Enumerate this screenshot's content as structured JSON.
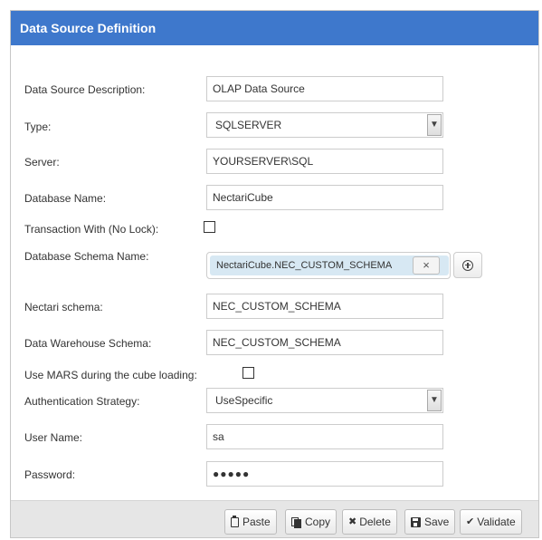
{
  "dialog": {
    "title": "Data Source Definition"
  },
  "form": {
    "description": {
      "label": "Data Source Description:",
      "value": "OLAP Data Source"
    },
    "type": {
      "label": "Type:",
      "value": "SQLSERVER"
    },
    "server": {
      "label": "Server:",
      "value": "YOURSERVER\\SQL"
    },
    "database_name": {
      "label": "Database Name:",
      "value": "NectariCube"
    },
    "transaction_nolock": {
      "label": "Transaction With (No Lock):",
      "checked": false
    },
    "schema_name": {
      "label": "Database Schema Name:",
      "tags": [
        "NectariCube.NEC_CUSTOM_SCHEMA"
      ],
      "remove_symbol": "×"
    },
    "nectari_schema": {
      "label": "Nectari schema:",
      "value": "NEC_CUSTOM_SCHEMA"
    },
    "dw_schema": {
      "label": "Data Warehouse Schema:",
      "value": "NEC_CUSTOM_SCHEMA"
    },
    "use_mars": {
      "label": "Use MARS during the cube loading:",
      "checked": false
    },
    "auth_strategy": {
      "label": "Authentication Strategy:",
      "value": "UseSpecific"
    },
    "user_name": {
      "label": "User Name:",
      "value": "sa"
    },
    "password": {
      "label": "Password:",
      "value": "●●●●●"
    }
  },
  "footer": {
    "paste_label": "Paste",
    "copy_label": "Copy",
    "delete_label": "Delete",
    "save_label": "Save",
    "validate_label": "Validate"
  },
  "icons": {
    "dropdown": "chevron-down-icon",
    "add": "plus-circle-icon",
    "paste": "clipboard-icon",
    "copy": "copy-icon",
    "delete": "x-icon",
    "save": "floppy-disk-icon",
    "validate": "checkmark-icon"
  },
  "colors": {
    "titlebar": "#3e78cc",
    "tag": "#d7e8f3",
    "footer": "#e6e6e6"
  }
}
